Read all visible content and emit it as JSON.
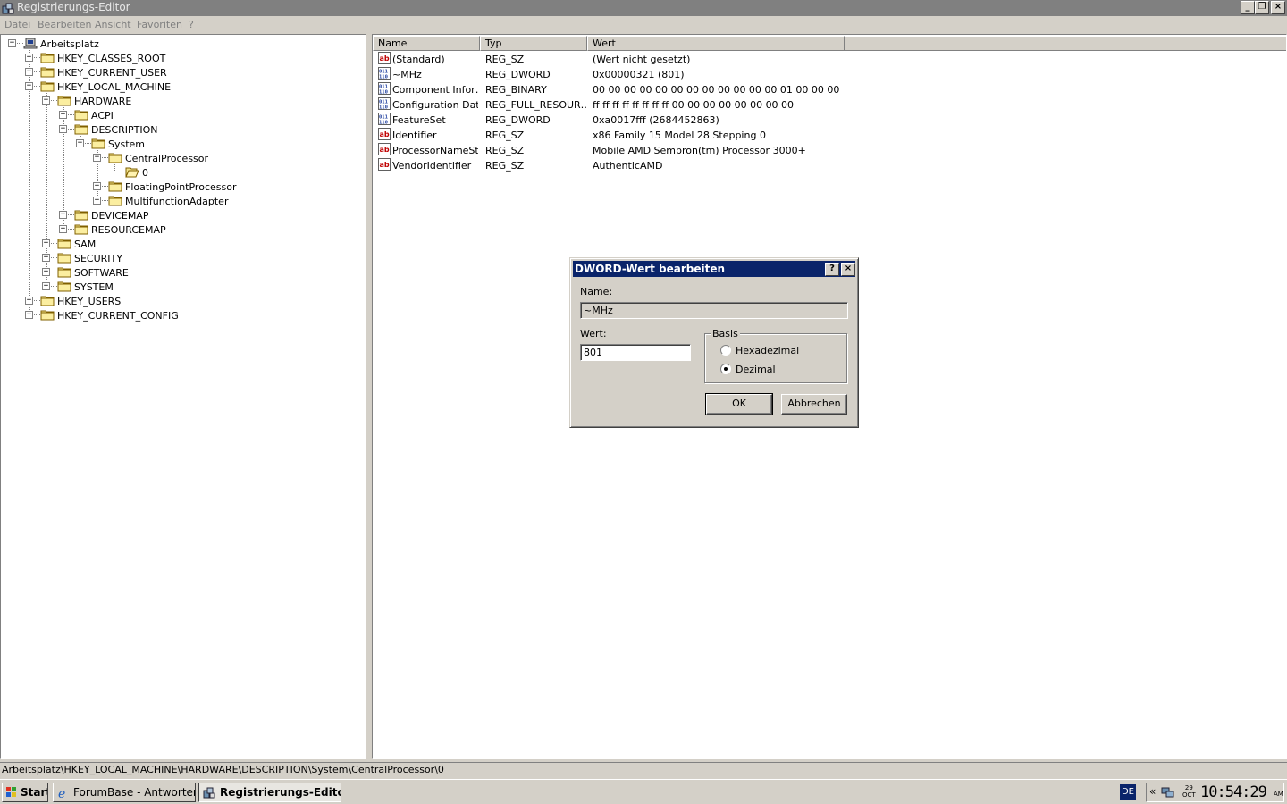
{
  "window": {
    "title": "Registrierungs-Editor",
    "minimize_glyph": "_",
    "restore_glyph": "❐",
    "close_glyph": "×"
  },
  "menu": [
    "Datei",
    "Bearbeiten",
    "Ansicht",
    "Favoriten",
    "?"
  ],
  "tree": [
    {
      "label": "Arbeitsplatz",
      "icon": "computer-icon",
      "expander": "−"
    },
    {
      "label": "HKEY_CLASSES_ROOT",
      "icon": "folder-icon",
      "expander": "+"
    },
    {
      "label": "HKEY_CURRENT_USER",
      "icon": "folder-icon",
      "expander": "+"
    },
    {
      "label": "HKEY_LOCAL_MACHINE",
      "icon": "folder-icon",
      "expander": "−"
    },
    {
      "label": "HARDWARE",
      "icon": "folder-icon",
      "expander": "−"
    },
    {
      "label": "ACPI",
      "icon": "folder-icon",
      "expander": "+"
    },
    {
      "label": "DESCRIPTION",
      "icon": "folder-icon",
      "expander": "−"
    },
    {
      "label": "System",
      "icon": "folder-icon",
      "expander": "−"
    },
    {
      "label": "CentralProcessor",
      "icon": "folder-icon",
      "expander": "−"
    },
    {
      "label": "0",
      "icon": "open-folder-icon",
      "expander": ""
    },
    {
      "label": "FloatingPointProcessor",
      "icon": "folder-icon",
      "expander": "+"
    },
    {
      "label": "MultifunctionAdapter",
      "icon": "folder-icon",
      "expander": "+"
    },
    {
      "label": "DEVICEMAP",
      "icon": "folder-icon",
      "expander": "+"
    },
    {
      "label": "RESOURCEMAP",
      "icon": "folder-icon",
      "expander": "+"
    },
    {
      "label": "SAM",
      "icon": "folder-icon",
      "expander": "+"
    },
    {
      "label": "SECURITY",
      "icon": "folder-icon",
      "expander": "+"
    },
    {
      "label": "SOFTWARE",
      "icon": "folder-icon",
      "expander": "+"
    },
    {
      "label": "SYSTEM",
      "icon": "folder-icon",
      "expander": "+"
    },
    {
      "label": "HKEY_USERS",
      "icon": "folder-icon",
      "expander": "+"
    },
    {
      "label": "HKEY_CURRENT_CONFIG",
      "icon": "folder-icon",
      "expander": "+"
    }
  ],
  "list": {
    "columns": [
      "Name",
      "Typ",
      "Wert"
    ],
    "rows": [
      {
        "icon": "string-value-icon",
        "name": "(Standard)",
        "type": "REG_SZ",
        "value": "(Wert nicht gesetzt)"
      },
      {
        "icon": "binary-value-icon",
        "name": "~MHz",
        "type": "REG_DWORD",
        "value": "0x00000321 (801)"
      },
      {
        "icon": "binary-value-icon",
        "name": "Component Infor…",
        "type": "REG_BINARY",
        "value": "00 00 00 00 00 00 00 00 00 00 00 00 01 00 00 00"
      },
      {
        "icon": "binary-value-icon",
        "name": "Configuration Data",
        "type": "REG_FULL_RESOUR…",
        "value": "ff ff ff ff ff ff ff ff 00 00 00 00 00 00 00 00"
      },
      {
        "icon": "binary-value-icon",
        "name": "FeatureSet",
        "type": "REG_DWORD",
        "value": "0xa0017fff (2684452863)"
      },
      {
        "icon": "string-value-icon",
        "name": "Identifier",
        "type": "REG_SZ",
        "value": "x86 Family 15 Model 28 Stepping 0"
      },
      {
        "icon": "string-value-icon",
        "name": "ProcessorNameSt…",
        "type": "REG_SZ",
        "value": "Mobile AMD Sempron(tm) Processor 3000+"
      },
      {
        "icon": "string-value-icon",
        "name": "VendorIdentifier",
        "type": "REG_SZ",
        "value": "AuthenticAMD"
      }
    ]
  },
  "dialog": {
    "title": "DWORD-Wert bearbeiten",
    "help_glyph": "?",
    "close_glyph": "×",
    "name_label": "Name:",
    "name_value": "~MHz",
    "value_label": "Wert:",
    "value": "801",
    "base_label": "Basis",
    "hex_label": "Hexadezimal",
    "dec_label": "Dezimal",
    "selected_base": "Dezimal",
    "ok_label": "OK",
    "cancel_label": "Abbrechen"
  },
  "statusbar": "Arbeitsplatz\\HKEY_LOCAL_MACHINE\\HARDWARE\\DESCRIPTION\\System\\CentralProcessor\\0",
  "taskbar": {
    "start_label": "Start",
    "tasks": [
      {
        "label": "ForumBase - Antworten ...",
        "icon": "ie-icon",
        "active": false
      },
      {
        "label": "Registrierungs-Editor",
        "icon": "regedit-icon",
        "active": true
      }
    ],
    "language": "DE",
    "tray_chevron": "«",
    "date_day": "29",
    "date_month": "OCT",
    "clock": "10:54:29",
    "ampm": "AM"
  },
  "colors": {
    "dialog_title_bg": "#0a246a",
    "window_title_inactive": "#808080",
    "face": "#d4d0c8"
  }
}
